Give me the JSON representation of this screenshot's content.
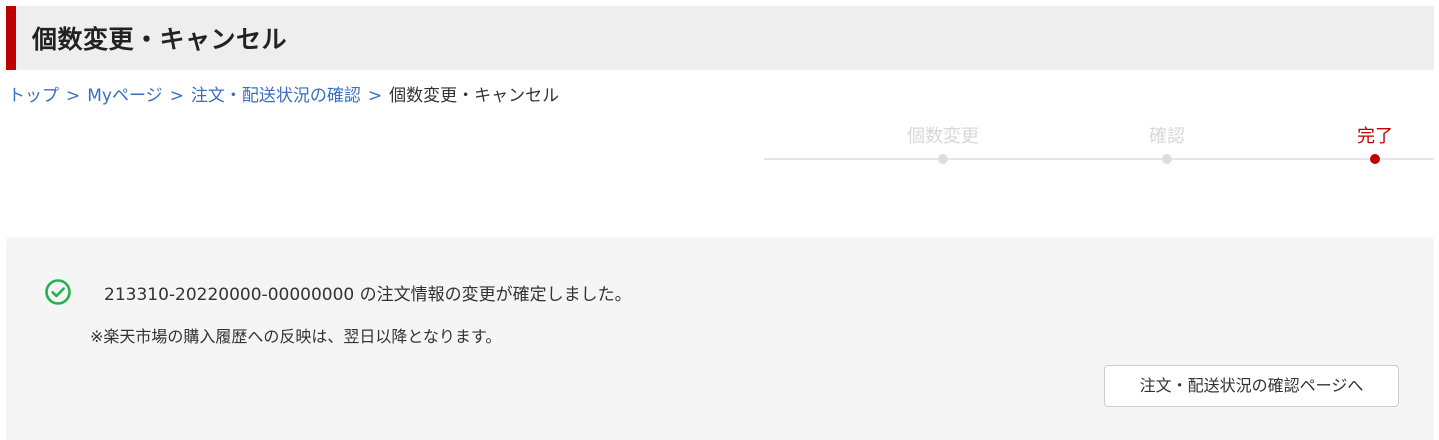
{
  "header": {
    "title": "個数変更・キャンセル"
  },
  "breadcrumb": {
    "items": [
      {
        "label": "トップ",
        "link": true
      },
      {
        "label": "Myページ",
        "link": true
      },
      {
        "label": "注文・配送状況の確認",
        "link": true
      },
      {
        "label": "個数変更・キャンセル",
        "link": false
      }
    ],
    "separator": ">"
  },
  "stepper": {
    "steps": [
      {
        "label": "個数変更",
        "active": false
      },
      {
        "label": "確認",
        "active": false
      },
      {
        "label": "完了",
        "active": true
      }
    ]
  },
  "result": {
    "icon": "check-circle-icon",
    "message": "213310-20220000-00000000 の注文情報の変更が確定しました。",
    "note": "※楽天市場の購入履歴への反映は、翌日以降となります。",
    "button_label": "注文・配送状況の確認ページへ"
  },
  "colors": {
    "accent": "#bf0000",
    "link": "#3a6fbf",
    "success": "#22b14c",
    "panel_bg": "#f5f5f5"
  }
}
